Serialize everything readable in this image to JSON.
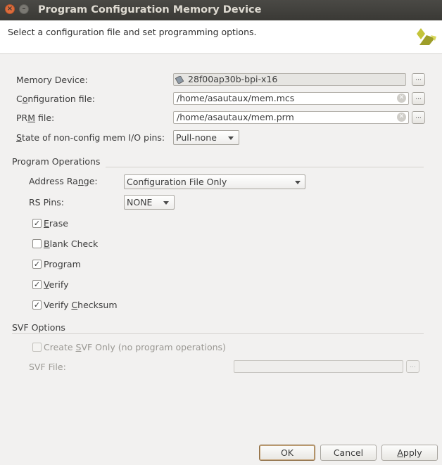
{
  "window": {
    "title": "Program Configuration Memory Device"
  },
  "header": {
    "subtitle": "Select a configuration file and set programming options."
  },
  "form": {
    "memory_device": {
      "label": "Memory Device:",
      "value": "28f00ap30b-bpi-x16",
      "browse": "..."
    },
    "config_file": {
      "label": "Configuration file:",
      "value": "/home/asautaux/mem.mcs",
      "browse": "..."
    },
    "prm_file": {
      "label": "PRM file:",
      "value": "/home/asautaux/mem.prm",
      "browse": "..."
    },
    "state_pins": {
      "label": "State of non-config mem I/O pins:",
      "value": "Pull-none"
    }
  },
  "program_operations": {
    "title": "Program Operations",
    "address_range": {
      "label": "Address Range:",
      "value": "Configuration File Only"
    },
    "rs_pins": {
      "label": "RS Pins:",
      "value": "NONE"
    },
    "options": [
      {
        "label": "Erase",
        "checked": true
      },
      {
        "label": "Blank Check",
        "checked": false
      },
      {
        "label": "Program",
        "checked": true
      },
      {
        "label": "Verify",
        "checked": true
      },
      {
        "label": "Verify Checksum",
        "checked": true
      }
    ]
  },
  "svf_options": {
    "title": "SVF Options",
    "create_svf": {
      "label": "Create SVF Only (no program operations)",
      "checked": false,
      "enabled": false
    },
    "svf_file": {
      "label": "SVF File:",
      "value": "",
      "browse": "..."
    }
  },
  "buttons": {
    "ok": "OK",
    "cancel": "Cancel",
    "apply": "Apply"
  },
  "colors": {
    "titlebar": "#3c3b37",
    "close": "#dd6c3c",
    "logo_yellow": "#c4c43a"
  },
  "icons": {
    "close": "close-icon",
    "minimize": "minimize-icon",
    "device": "chip-icon",
    "logo": "xilinx-logo"
  }
}
